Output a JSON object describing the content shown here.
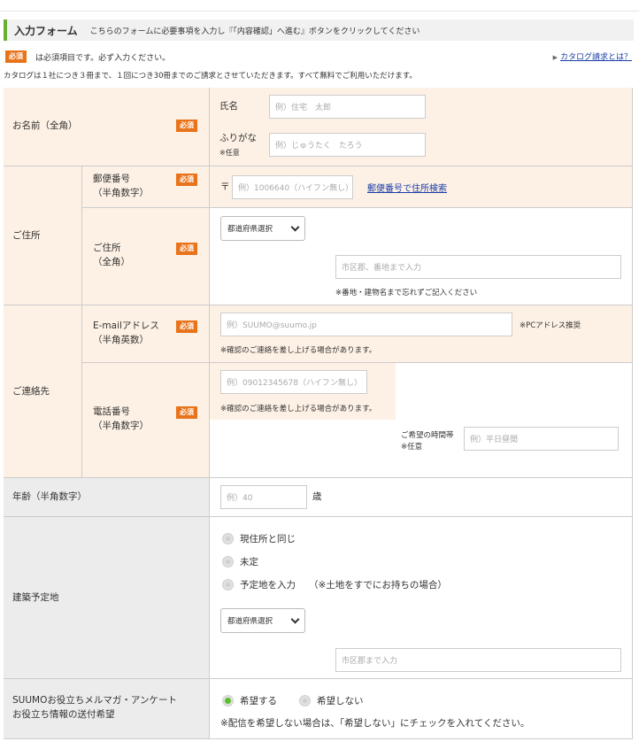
{
  "header": {
    "title": "入力フォーム",
    "description": "こちらのフォームに必要事項を入力し『「内容確認」へ進む』ボタンをクリックしてください"
  },
  "required_note": {
    "badge": "必須",
    "text": "は必須項目です。必ず入力ください。"
  },
  "catalog_link": "カタログ請求とは？",
  "catalog_note": "カタログは１社につき３冊まで、１回につき30冊までのご請求とさせていただきます。すべて無料でご利用いただけます。",
  "badge_required": "必須",
  "name_section": {
    "label": "お名前（全角）",
    "name_label": "氏名",
    "name_placeholder": "例）住宅　太郎",
    "furigana_label": "ふりがな",
    "furigana_optional": "※任意",
    "furigana_placeholder": "例）じゅうたく　たろう"
  },
  "address_section": {
    "label": "ご住所",
    "postal_label": "郵便番号",
    "postal_sub": "（半角数字）",
    "postal_mark": "〒",
    "postal_placeholder": "例）1006640（ハイフン無し）",
    "postal_search_link": "郵便番号で住所検索",
    "address_label": "ご住所",
    "address_sub": "（全角）",
    "prefecture_select": "都道府県選択",
    "city_placeholder": "市区郡、番地まで入力",
    "address_note": "※番地・建物名まで忘れずご記入ください"
  },
  "contact_section": {
    "label": "ご連絡先",
    "email_label": "E-mailアドレス",
    "email_sub": "（半角英数）",
    "email_placeholder": "例）SUUMO@suumo.jp",
    "email_pc_note": "※PCアドレス推奨",
    "email_note": "※確認のご連絡を差し上げる場合があります。",
    "phone_label": "電話番号",
    "phone_sub": "（半角数字）",
    "phone_placeholder": "例）09012345678（ハイフン無し）",
    "phone_note": "※確認のご連絡を差し上げる場合があります。",
    "time_label": "ご希望の時間帯",
    "time_optional": "※任意",
    "time_placeholder": "例）平日昼間"
  },
  "age_section": {
    "label": "年齢（半角数字）",
    "placeholder": "例）40",
    "unit": "歳"
  },
  "site_section": {
    "label": "建築予定地",
    "options": [
      "現住所と同じ",
      "未定",
      "予定地を入力"
    ],
    "option3_note": "（※土地をすでにお持ちの場合）",
    "prefecture_select": "都道府県選択",
    "city_placeholder": "市区郡まで入力"
  },
  "mail_section": {
    "label_line1": "SUUMOお役立ちメルマガ・アンケート",
    "label_line2": "お役立ち情報の送付希望",
    "yes": "希望する",
    "no": "希望しない",
    "note": "※配信を希望しない場合は、「希望しない」にチェックを入れてください。"
  },
  "colors": {
    "accent_green": "#66b032",
    "badge_orange": "#e8731a",
    "label_bg": "#fdf1e5",
    "gray_bg": "#ececec",
    "link_blue": "#1a3da8"
  }
}
